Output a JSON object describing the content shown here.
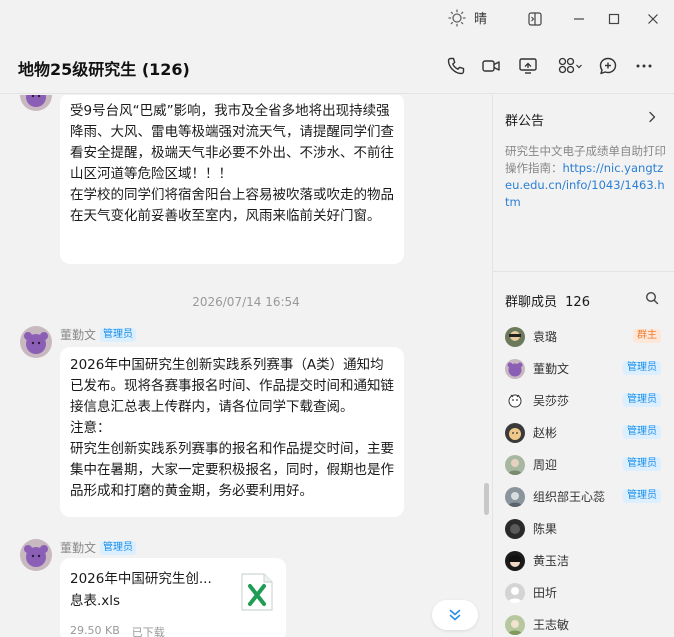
{
  "titlebar": {
    "weather_text": "晴"
  },
  "header": {
    "title": "地物25级研究生 (126)"
  },
  "chat": {
    "messages": [
      {
        "text": "受9号台风“巴威”影响，我市及全省多地将出现持续强降雨、大风、雷电等极端强对流天气，请提醒同学们查看安全提醒，极端天气非必要不外出、不涉水、不前往山区河道等危险区域！！！\n在学校的同学们将宿舍阳台上容易被吹落或吹走的物品在天气变化前妥善收至室内，风雨来临前关好门窗。"
      },
      {
        "timestamp": "2026/07/14 16:54"
      },
      {
        "sender": "董勤文",
        "role": "管理员",
        "text": "2026年中国研究生创新实践系列赛事（A类）通知均已发布。现将各赛事报名时间、作品提交时间和通知链接信息汇总表上传群内，请各位同学下载查阅。\n注意：\n研究生创新实践系列赛事的报名和作品提交时间，主要集中在暑期，大家一定要积极报名，同时，假期也是作品形成和打磨的黄金期，务必要利用好。"
      },
      {
        "sender": "董勤文",
        "role": "管理员",
        "file": {
          "name": "2026年中国研究生创...息表.xls",
          "name_line1": "2026年中国研究生创...",
          "name_line2": "息表.xls",
          "size": "29.50 KB",
          "status": "已下载"
        }
      }
    ]
  },
  "panel": {
    "notice": {
      "title": "群公告",
      "body": "研究生中文电子成绩单自助打印操作指南：",
      "link": "https://nic.yangtzeu.edu.cn/info/1043/1463.htm"
    },
    "members": {
      "title": "群聊成员",
      "count": "126",
      "list": [
        {
          "name": "袁璐",
          "badge": "群主",
          "badge_type": "owner"
        },
        {
          "name": "董勤文",
          "badge": "管理员",
          "badge_type": "admin"
        },
        {
          "name": "吴莎莎",
          "badge": "管理员",
          "badge_type": "admin"
        },
        {
          "name": "赵彬",
          "badge": "管理员",
          "badge_type": "admin"
        },
        {
          "name": "周迎",
          "badge": "管理员",
          "badge_type": "admin"
        },
        {
          "name": "组织部王心蕊",
          "badge": "管理员",
          "badge_type": "admin"
        },
        {
          "name": "陈果",
          "badge": "",
          "badge_type": ""
        },
        {
          "name": "黄玉洁",
          "badge": "",
          "badge_type": ""
        },
        {
          "name": "田圻",
          "badge": "",
          "badge_type": ""
        },
        {
          "name": "王志敏",
          "badge": "",
          "badge_type": ""
        }
      ]
    }
  }
}
